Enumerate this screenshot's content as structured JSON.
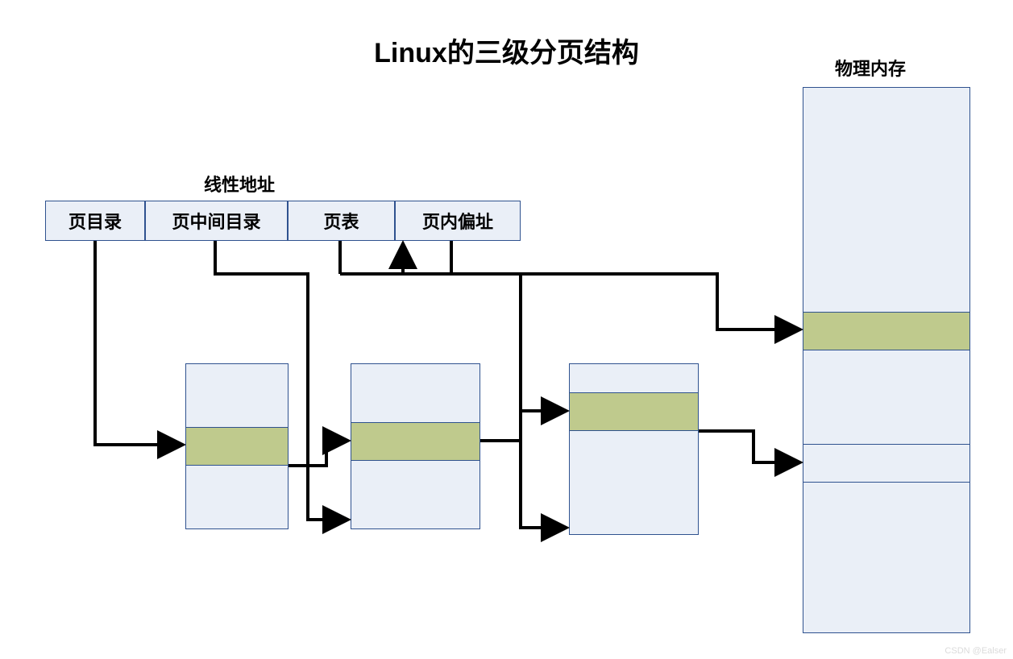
{
  "title": "Linux的三级分页结构",
  "linear_addr_label": "线性地址",
  "phys_mem_label": "物理内存",
  "addr_parts": [
    "页目录",
    "页中间目录",
    "页表",
    "页内偏址"
  ],
  "colors": {
    "box_fill": "#eaeff7",
    "box_border": "#2f528f",
    "highlight": "#bfca8d",
    "arrow": "#000000"
  },
  "watermark": "CSDN @Ealser"
}
